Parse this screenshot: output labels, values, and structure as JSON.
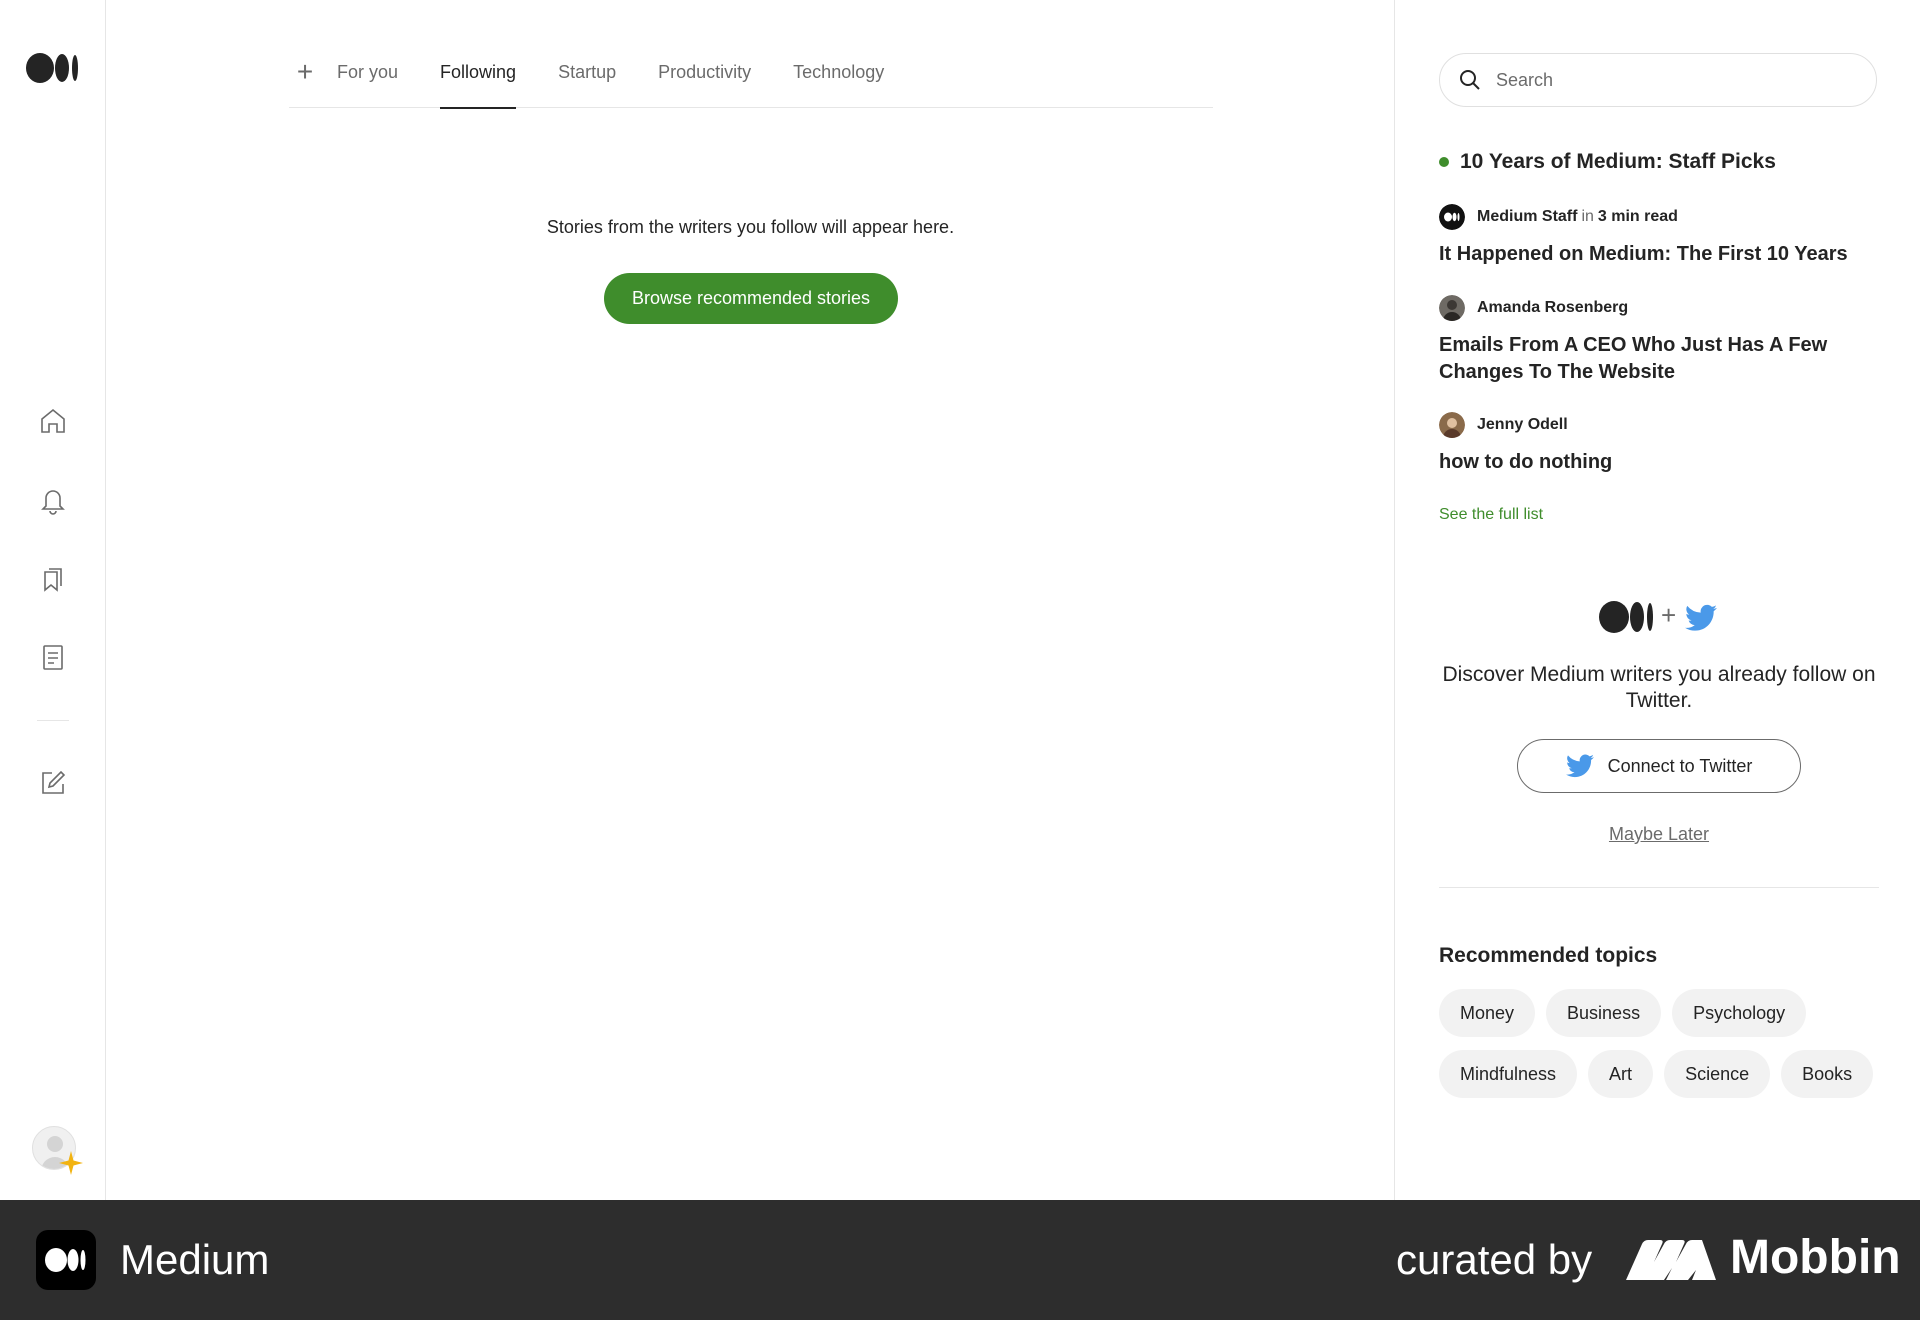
{
  "rail": {
    "items": [
      "home",
      "notifications",
      "library",
      "stories",
      "write"
    ]
  },
  "tabs": {
    "plus_label": "+",
    "items": [
      {
        "label": "For you"
      },
      {
        "label": "Following"
      },
      {
        "label": "Startup"
      },
      {
        "label": "Productivity"
      },
      {
        "label": "Technology"
      }
    ],
    "active": "Following"
  },
  "feed": {
    "empty_message": "Stories from the writers you follow will appear here.",
    "browse_button": "Browse recommended stories"
  },
  "sidebar": {
    "search_placeholder": "Search",
    "staff_picks": {
      "heading": "10 Years of Medium: Staff Picks",
      "items": [
        {
          "author": "Medium Staff",
          "in_word": "in",
          "meta": "3 min read",
          "title": "It Happened on Medium: The First 10 Years"
        },
        {
          "author": "Amanda Rosenberg",
          "title": "Emails From A CEO Who Just Has A Few Changes To The Website"
        },
        {
          "author": "Jenny Odell",
          "title": "how to do nothing"
        }
      ],
      "see_full_list": "See the full list"
    },
    "twitter": {
      "plus": "+",
      "text": "Discover Medium writers you already follow on Twitter.",
      "connect_button": "Connect to Twitter",
      "maybe_later": "Maybe Later"
    },
    "topics": {
      "heading": "Recommended topics",
      "items": [
        "Money",
        "Business",
        "Psychology",
        "Mindfulness",
        "Art",
        "Science",
        "Books"
      ]
    }
  },
  "banner": {
    "app_name": "Medium",
    "curated_by": "curated by",
    "brand": "Mobbin"
  },
  "colors": {
    "accent_green": "#3f8d2c",
    "twitter_blue": "#4a99e9",
    "banner_bg": "#2d2d2d"
  }
}
